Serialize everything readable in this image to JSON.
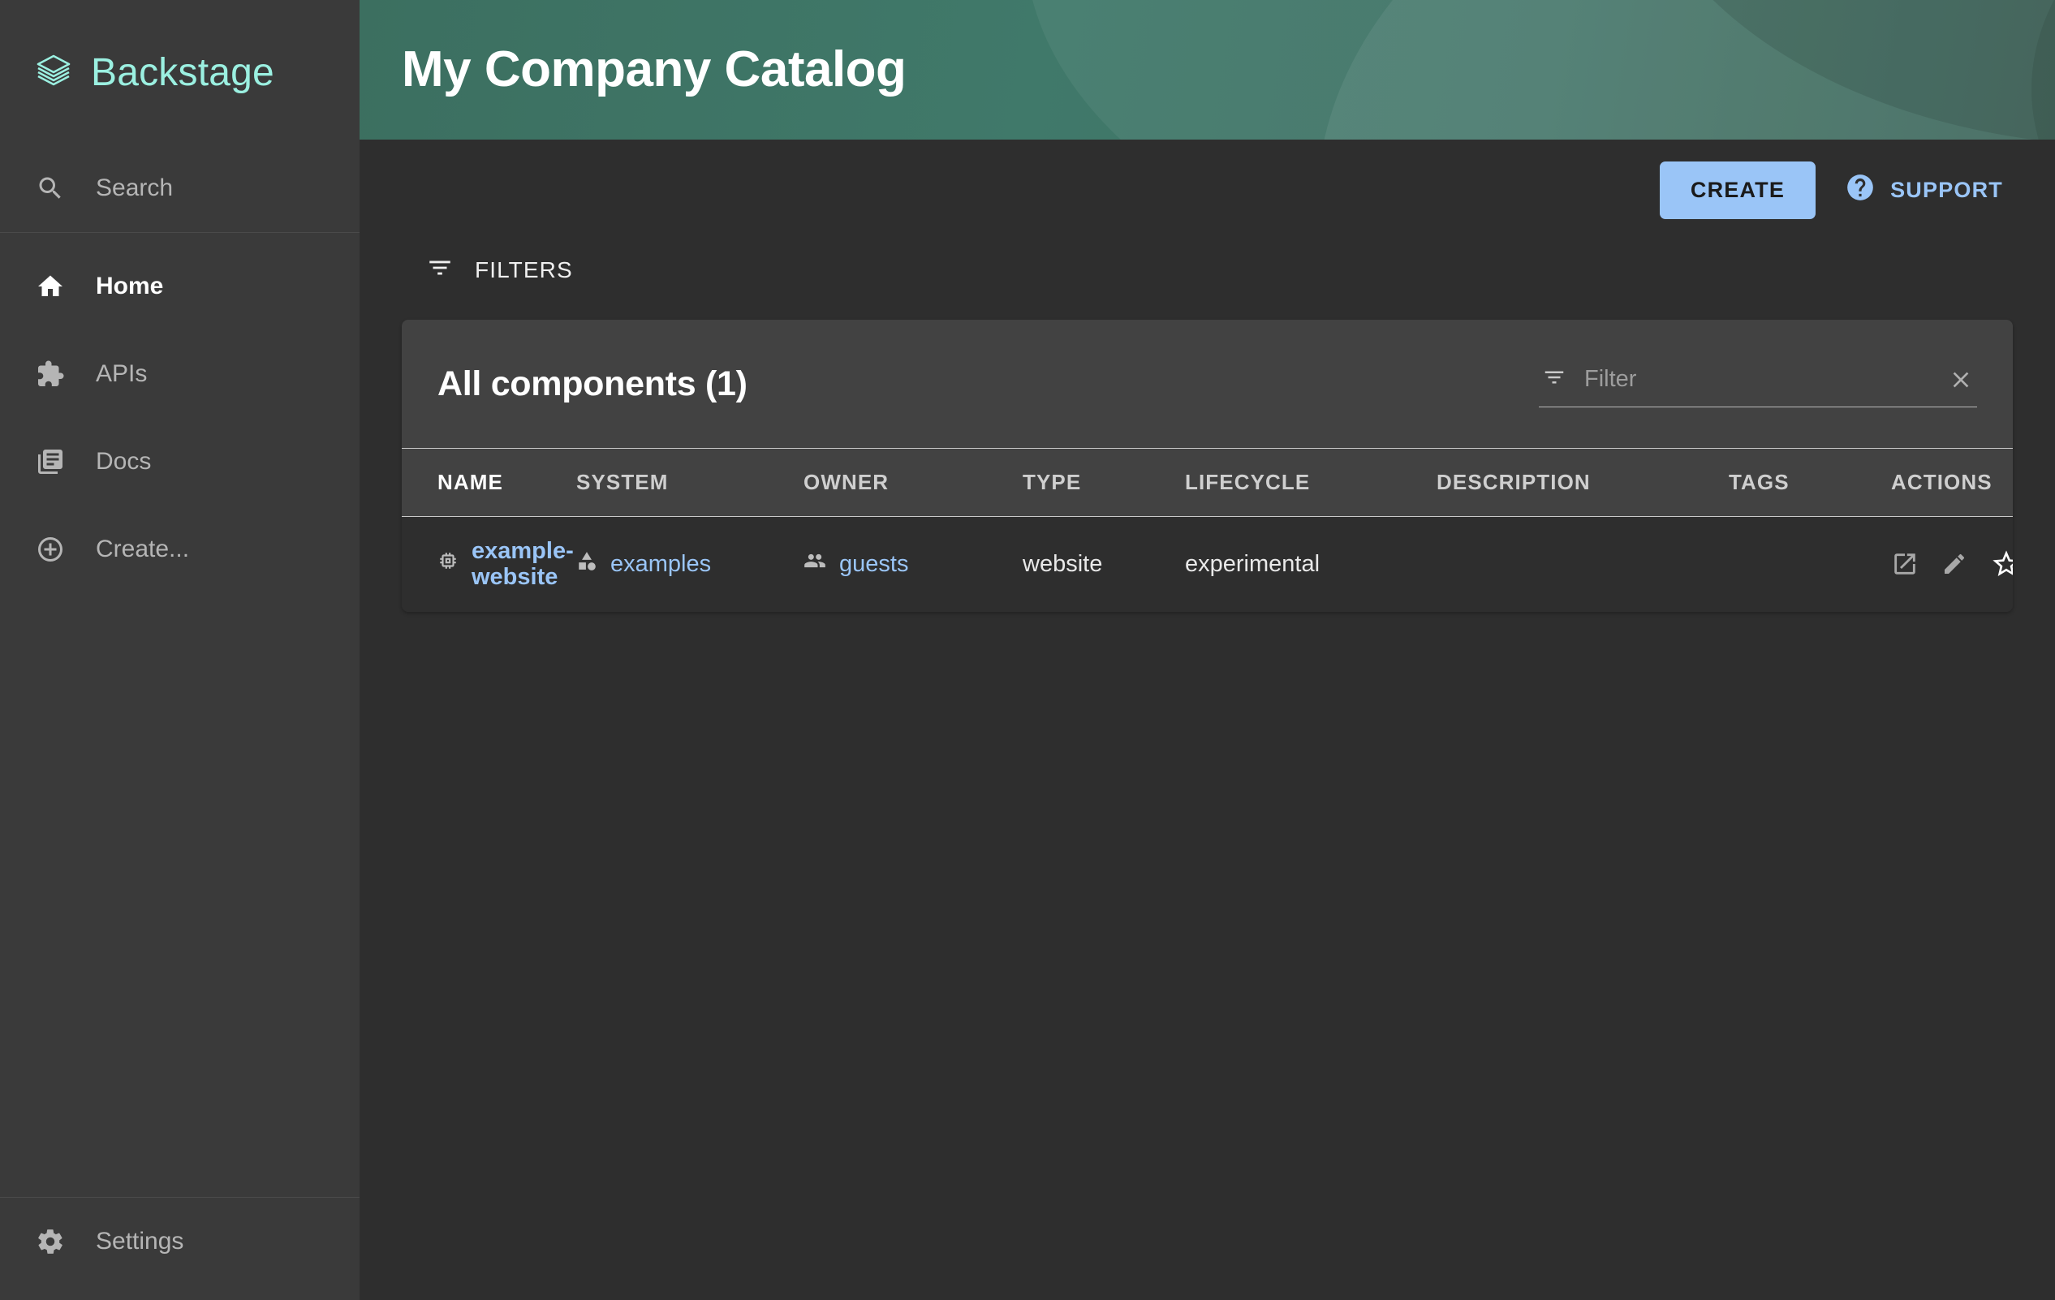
{
  "sidebar": {
    "brand": {
      "label": "Backstage",
      "logo_icon": "backstage-stack-logo",
      "color": "#9bf0e1"
    },
    "search": {
      "label": "Search",
      "icon": "search-icon"
    },
    "items": [
      {
        "label": "Home",
        "icon": "home-icon",
        "active": true
      },
      {
        "label": "APIs",
        "icon": "puzzle-piece-icon",
        "active": false
      },
      {
        "label": "Docs",
        "icon": "library-books-icon",
        "active": false
      },
      {
        "label": "Create...",
        "icon": "plus-circle-icon",
        "active": false
      }
    ],
    "settings": {
      "label": "Settings",
      "icon": "gear-icon"
    }
  },
  "header": {
    "title": "My Company Catalog",
    "background_color": "#40796a"
  },
  "toolbar": {
    "create_label": "CREATE",
    "create_color": "#9ac5f7",
    "support_label": "SUPPORT",
    "support_icon": "help-circle-icon",
    "filters_label": "FILTERS",
    "filters_icon": "filter-list-icon"
  },
  "catalog": {
    "card_title": "All components (1)",
    "filter": {
      "placeholder": "Filter",
      "value": "",
      "icon": "filter-list-icon",
      "clear_icon": "close-icon"
    },
    "columns": [
      {
        "label": "NAME",
        "sorted": true
      },
      {
        "label": "SYSTEM",
        "sorted": false
      },
      {
        "label": "OWNER",
        "sorted": false
      },
      {
        "label": "TYPE",
        "sorted": false
      },
      {
        "label": "LIFECYCLE",
        "sorted": false
      },
      {
        "label": "DESCRIPTION",
        "sorted": false
      },
      {
        "label": "TAGS",
        "sorted": false
      },
      {
        "label": "ACTIONS",
        "sorted": false
      }
    ],
    "rows": [
      {
        "name": "example-website",
        "name_icon": "memory-chip-icon",
        "system": "examples",
        "system_icon": "category-shapes-icon",
        "owner": "guests",
        "owner_icon": "people-icon",
        "type": "website",
        "lifecycle": "experimental",
        "description": "",
        "tags": "",
        "actions": [
          "open-in-new-icon",
          "edit-pencil-icon",
          "star-outline-icon"
        ]
      }
    ]
  }
}
